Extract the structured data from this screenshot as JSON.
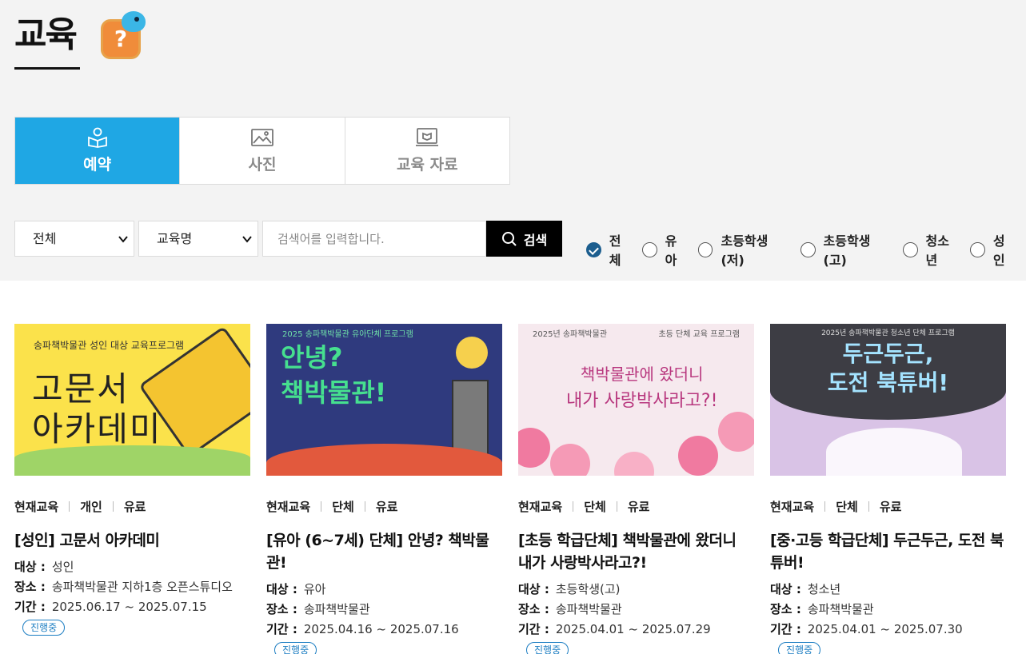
{
  "page_title": "교육",
  "tabs": [
    {
      "label": "예약",
      "icon": "reader-icon",
      "active": true
    },
    {
      "label": "사진",
      "icon": "photo-icon",
      "active": false
    },
    {
      "label": "교육 자료",
      "icon": "monitor-book-icon",
      "active": false
    }
  ],
  "search": {
    "category_selected": "전체",
    "field_selected": "교육명",
    "placeholder": "검색어를 입력합니다.",
    "button_label": "검색"
  },
  "audience_filters": [
    {
      "label": "전체",
      "checked": true
    },
    {
      "label": "유아",
      "checked": false
    },
    {
      "label": "초등학생(저)",
      "checked": false
    },
    {
      "label": "초등학생(고)",
      "checked": false
    },
    {
      "label": "청소년",
      "checked": false
    },
    {
      "label": "성인",
      "checked": false
    }
  ],
  "labels": {
    "target": "대상 :",
    "place": "장소 :",
    "period": "기간 :"
  },
  "cards": [
    {
      "tags": [
        "현재교육",
        "개인",
        "유료"
      ],
      "title": "[성인] 고문서 아카데미",
      "target": "성인",
      "place": "송파책박물관 지하1층 오픈스튜디오",
      "period": "2025.06.17 ~ 2025.07.15",
      "status": "진행중",
      "thumb": {
        "caption": "송파책박물관 성인 대상 교육프로그램",
        "line1": "고문서",
        "line2": "아카데미"
      }
    },
    {
      "tags": [
        "현재교육",
        "단체",
        "유료"
      ],
      "title": "[유아 (6~7세) 단체] 안녕? 책박물관!",
      "target": "유아",
      "place": "송파책박물관",
      "period": "2025.04.16 ~ 2025.07.16",
      "status": "진행중",
      "thumb": {
        "caption": "2025 송파책박물관 유아단체 프로그램",
        "line1": "안녕?",
        "line2": "책박물관!"
      }
    },
    {
      "tags": [
        "현재교육",
        "단체",
        "유료"
      ],
      "title": "[초등 학급단체] 책박물관에 왔더니 내가 사랑박사라고?!",
      "target": "초등학생(고)",
      "place": "송파책박물관",
      "period": "2025.04.01 ~ 2025.07.29",
      "status": "진행중",
      "thumb": {
        "caption": "2025년 송파책박물관",
        "caption2": "초등 단체 교육 프로그램",
        "line1": "책박물관에 왔더니",
        "line2": "내가 사랑박사라고?!"
      }
    },
    {
      "tags": [
        "현재교육",
        "단체",
        "유료"
      ],
      "title": "[중·고등 학급단체] 두근두근, 도전 북튜버!",
      "target": "청소년",
      "place": "송파책박물관",
      "period": "2025.04.01 ~ 2025.07.30",
      "status": "진행중",
      "thumb": {
        "caption": "2025년 송파책박물관 청소년 단체 프로그램",
        "line1": "두근두근,",
        "line2": "도전 북튜버!"
      }
    }
  ]
}
